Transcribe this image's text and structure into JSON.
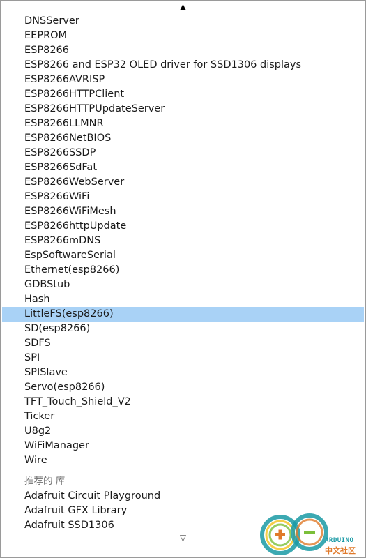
{
  "scroll": {
    "up_arrow": "▲",
    "down_arrow": "▽"
  },
  "libraries": [
    {
      "label": "DNSServer",
      "selected": false
    },
    {
      "label": "EEPROM",
      "selected": false
    },
    {
      "label": "ESP8266",
      "selected": false
    },
    {
      "label": "ESP8266 and ESP32 OLED driver for SSD1306 displays",
      "selected": false
    },
    {
      "label": "ESP8266AVRISP",
      "selected": false
    },
    {
      "label": "ESP8266HTTPClient",
      "selected": false
    },
    {
      "label": "ESP8266HTTPUpdateServer",
      "selected": false
    },
    {
      "label": "ESP8266LLMNR",
      "selected": false
    },
    {
      "label": "ESP8266NetBIOS",
      "selected": false
    },
    {
      "label": "ESP8266SSDP",
      "selected": false
    },
    {
      "label": "ESP8266SdFat",
      "selected": false
    },
    {
      "label": "ESP8266WebServer",
      "selected": false
    },
    {
      "label": "ESP8266WiFi",
      "selected": false
    },
    {
      "label": "ESP8266WiFiMesh",
      "selected": false
    },
    {
      "label": "ESP8266httpUpdate",
      "selected": false
    },
    {
      "label": "ESP8266mDNS",
      "selected": false
    },
    {
      "label": "EspSoftwareSerial",
      "selected": false
    },
    {
      "label": "Ethernet(esp8266)",
      "selected": false
    },
    {
      "label": "GDBStub",
      "selected": false
    },
    {
      "label": "Hash",
      "selected": false
    },
    {
      "label": "LittleFS(esp8266)",
      "selected": true
    },
    {
      "label": "SD(esp8266)",
      "selected": false
    },
    {
      "label": "SDFS",
      "selected": false
    },
    {
      "label": "SPI",
      "selected": false
    },
    {
      "label": "SPISlave",
      "selected": false
    },
    {
      "label": "Servo(esp8266)",
      "selected": false
    },
    {
      "label": "TFT_Touch_Shield_V2",
      "selected": false
    },
    {
      "label": "Ticker",
      "selected": false
    },
    {
      "label": "U8g2",
      "selected": false
    },
    {
      "label": "WiFiManager",
      "selected": false
    },
    {
      "label": "Wire",
      "selected": false
    }
  ],
  "recommended": {
    "header": "推荐的 库",
    "items": [
      {
        "label": "Adafruit Circuit Playground"
      },
      {
        "label": "Adafruit GFX Library"
      },
      {
        "label": "Adafruit SSD1306"
      }
    ]
  },
  "watermark": {
    "brand": "ARDUINO",
    "subtitle": "中文社区",
    "colors": {
      "teal": "#1a9aa5",
      "orange": "#e07a2b",
      "green": "#7bbf3a",
      "yellow": "#f2c21b"
    }
  },
  "colors": {
    "selection": "#a9d2f6",
    "border": "#9a9a9a",
    "header_text": "#707070"
  }
}
